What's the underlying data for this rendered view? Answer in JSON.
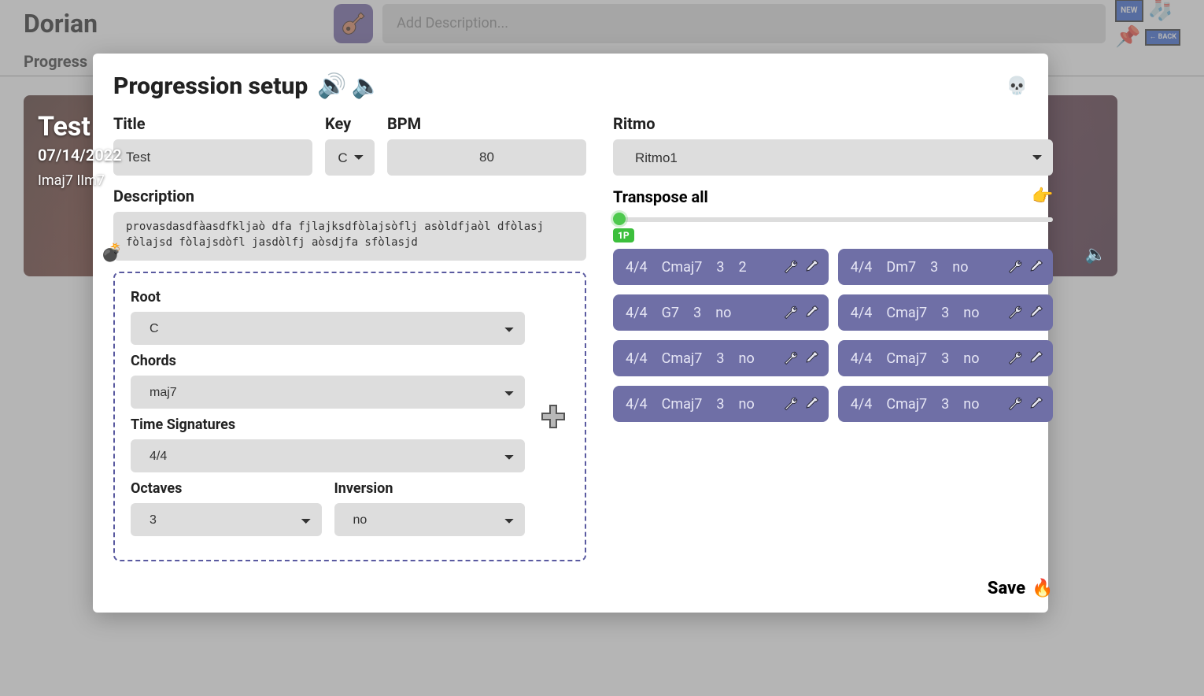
{
  "app": {
    "title": "Dorian"
  },
  "header": {
    "description_placeholder": "Add Description...",
    "new_label": "NEW",
    "back_label": "← BACK"
  },
  "tabs": {
    "progress": "Progress"
  },
  "card": {
    "title": "Test",
    "date": "07/14/2022",
    "chords": "Imaj7  IIm7"
  },
  "modal": {
    "title": "Progression setup",
    "labels": {
      "title": "Title",
      "key": "Key",
      "bpm": "BPM",
      "description": "Description",
      "root": "Root",
      "chords": "Chords",
      "time_signatures": "Time Signatures",
      "octaves": "Octaves",
      "inversion": "Inversion",
      "ritmo": "Ritmo",
      "transpose_all": "Transpose all"
    },
    "values": {
      "title": "Test",
      "key": "C",
      "bpm": "80",
      "description": "provasdasdfàasdfkljaò dfa fjlajksdfòlajsòflj asòldfjaòl dfòlasj fòlajsd fòlajsdòfl jasdòlfj aòsdjfa sfòlasjd",
      "root": "C",
      "chords": "maj7",
      "time_signatures": "4/4",
      "octaves": "3",
      "inversion": "no",
      "ritmo": "Ritmo1",
      "transpose_badge": "1P"
    },
    "chips": [
      {
        "ts": "4/4",
        "chord": "Cmaj7",
        "oct": "3",
        "inv": "2"
      },
      {
        "ts": "4/4",
        "chord": "Dm7",
        "oct": "3",
        "inv": "no"
      },
      {
        "ts": "4/4",
        "chord": "G7",
        "oct": "3",
        "inv": "no"
      },
      {
        "ts": "4/4",
        "chord": "Cmaj7",
        "oct": "3",
        "inv": "no"
      },
      {
        "ts": "4/4",
        "chord": "Cmaj7",
        "oct": "3",
        "inv": "no"
      },
      {
        "ts": "4/4",
        "chord": "Cmaj7",
        "oct": "3",
        "inv": "no"
      },
      {
        "ts": "4/4",
        "chord": "Cmaj7",
        "oct": "3",
        "inv": "no"
      },
      {
        "ts": "4/4",
        "chord": "Cmaj7",
        "oct": "3",
        "inv": "no"
      }
    ],
    "save": "Save"
  }
}
